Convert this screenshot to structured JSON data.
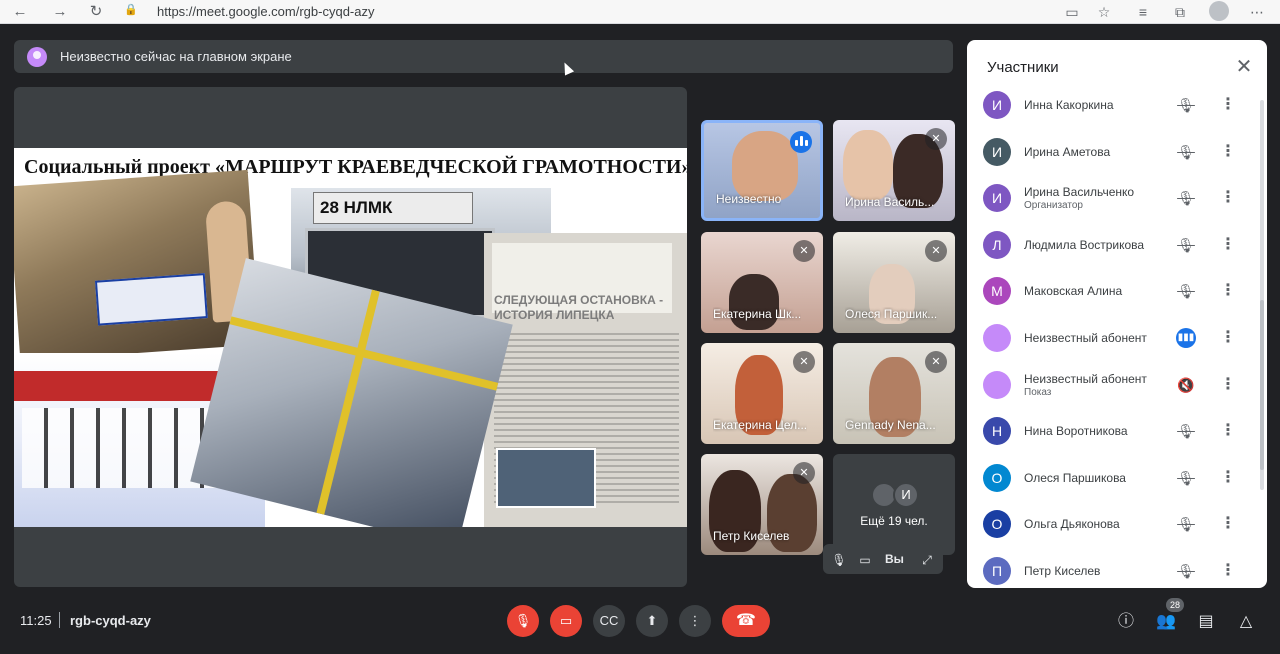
{
  "browser": {
    "url": "https://meet.google.com/rgb-cyqd-azy"
  },
  "presentation": {
    "banner_text": "Неизвестно сейчас на главном экране",
    "slide_title": "Социальный проект «МАРШРУТ КРАЕВЕДЧЕСКОЙ ГРАМОТНОСТИ»",
    "bus_sign": "28 НЛМК",
    "article_heading": "СЛЕДУЮЩАЯ ОСТАНОВКА - ИСТОРИЯ ЛИПЕЦКА"
  },
  "tiles": [
    {
      "name": "Неизвестно",
      "status": "speaking"
    },
    {
      "name": "Ирина Василь...",
      "status": "muted"
    },
    {
      "name": "Екатерина Шк...",
      "status": "muted"
    },
    {
      "name": "Олеся Паршик...",
      "status": "muted"
    },
    {
      "name": "Екатерина Цел...",
      "status": "muted"
    },
    {
      "name": "Gennady Nena...",
      "status": "muted"
    },
    {
      "name": "Петр Киселев",
      "status": "muted"
    }
  ],
  "more_tile": {
    "initial": "И",
    "label": "Ещё 19 чел."
  },
  "self_view": {
    "label": "Вы"
  },
  "participants_panel": {
    "title": "Участники",
    "participants": [
      {
        "initial": "И",
        "name": "Инна Какоркина",
        "role": "",
        "color": "#7e57c2",
        "mic": "muted"
      },
      {
        "initial": "И",
        "name": "Ирина Аметова",
        "role": "",
        "color": "#455a64",
        "mic": "muted"
      },
      {
        "initial": "И",
        "name": "Ирина Васильченко",
        "role": "Организатор",
        "color": "#7e57c2",
        "mic": "muted"
      },
      {
        "initial": "Л",
        "name": "Людмила Вострикова",
        "role": "",
        "color": "#7e57c2",
        "mic": "muted"
      },
      {
        "initial": "М",
        "name": "Маковская Алина",
        "role": "",
        "color": "#ab47bc",
        "mic": "muted"
      },
      {
        "initial": "",
        "name": "Неизвестный абонент",
        "role": "",
        "color": "#c58af9",
        "mic": "speaking"
      },
      {
        "initial": "",
        "name": "Неизвестный абонент",
        "role": "Показ",
        "color": "#c58af9",
        "mic": "presenting"
      },
      {
        "initial": "Н",
        "name": "Нина Воротникова",
        "role": "",
        "color": "#3949ab",
        "mic": "muted"
      },
      {
        "initial": "О",
        "name": "Олеся Паршикова",
        "role": "",
        "color": "#0288d1",
        "mic": "muted"
      },
      {
        "initial": "О",
        "name": "Ольга Дьяконова",
        "role": "",
        "color": "#1a3fa3",
        "mic": "muted"
      },
      {
        "initial": "П",
        "name": "Петр Киселев",
        "role": "",
        "color": "#5c6bc0",
        "mic": "muted"
      }
    ]
  },
  "bottom_bar": {
    "time": "11:25",
    "meeting_code": "rgb-cyqd-azy",
    "participant_count": "28"
  }
}
